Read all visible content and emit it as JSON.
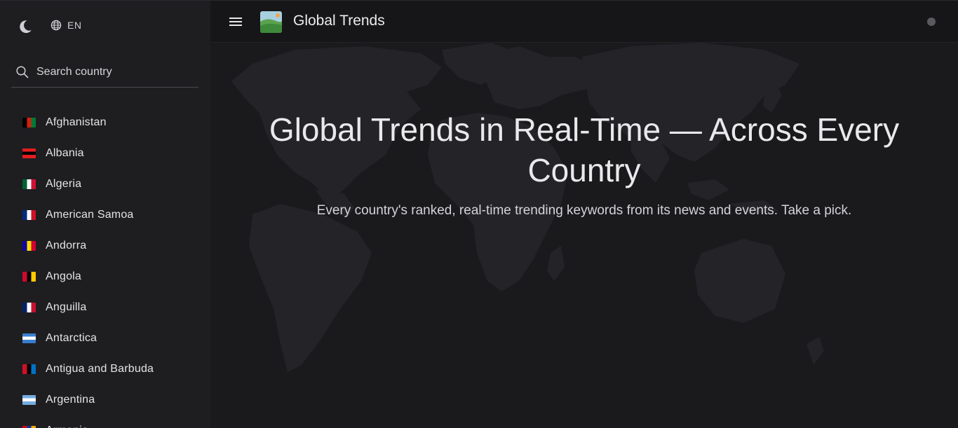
{
  "sidebar": {
    "language_label": "EN",
    "search": {
      "placeholder": "Search country",
      "value": ""
    },
    "countries": [
      {
        "name": "Afghanistan",
        "flag_colors": [
          "#000000",
          "#d32011",
          "#007a36"
        ]
      },
      {
        "name": "Albania",
        "flag_colors": [
          "#e41e20",
          "#000000"
        ]
      },
      {
        "name": "Algeria",
        "flag_colors": [
          "#006233",
          "#ffffff",
          "#d21034"
        ]
      },
      {
        "name": "American Samoa",
        "flag_colors": [
          "#002b7f",
          "#ffffff",
          "#ce1126"
        ]
      },
      {
        "name": "Andorra",
        "flag_colors": [
          "#10069f",
          "#fedf00",
          "#d50032"
        ]
      },
      {
        "name": "Angola",
        "flag_colors": [
          "#cc092f",
          "#000000",
          "#ffcb00"
        ]
      },
      {
        "name": "Anguilla",
        "flag_colors": [
          "#012169",
          "#ffffff",
          "#c8102e"
        ]
      },
      {
        "name": "Antarctica",
        "flag_colors": [
          "#3a7dce",
          "#ffffff"
        ]
      },
      {
        "name": "Antigua and Barbuda",
        "flag_colors": [
          "#ce1126",
          "#000000",
          "#0072c6"
        ]
      },
      {
        "name": "Argentina",
        "flag_colors": [
          "#74acdf",
          "#ffffff"
        ]
      },
      {
        "name": "Armenia",
        "flag_colors": [
          "#d90012",
          "#0033a0",
          "#f2a800"
        ]
      }
    ]
  },
  "header": {
    "app_title": "Global Trends"
  },
  "hero": {
    "title": "Global Trends in Real-Time — Across Every Country",
    "subtitle": "Every country's ranked, real-time trending keywords from its news and events. Take a pick."
  },
  "icons": {
    "theme": "moon-icon",
    "language": "globe-icon",
    "search": "search-icon",
    "menu": "hamburger-menu-icon",
    "logo": "landscape-logo-icon",
    "status": "status-dot-icon"
  },
  "colors": {
    "background": "#17171a",
    "sidebar": "#1e1e21",
    "map": "#242428",
    "text": "#e8e8ea"
  }
}
